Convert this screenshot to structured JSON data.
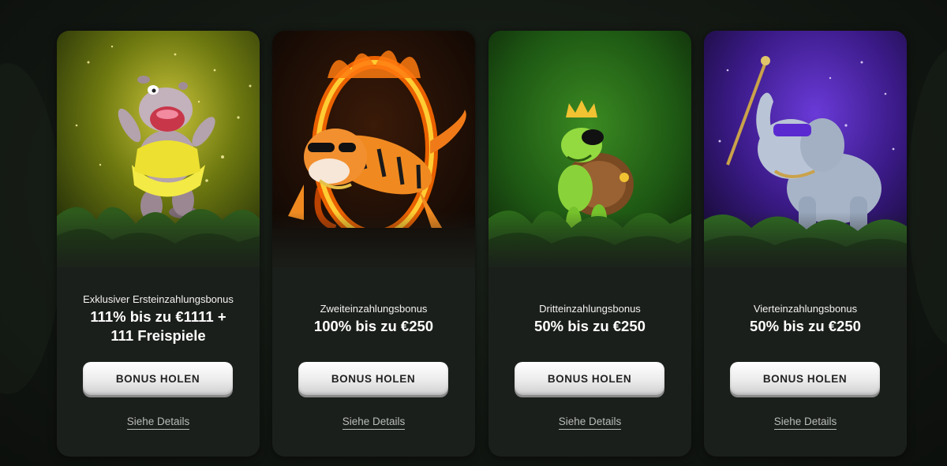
{
  "cards": [
    {
      "subtitle": "Exklusiver Ersteinzahlungsbonus",
      "offer": "111% bis zu €1111 + 111 Freispiele",
      "button_label": "BONUS HOLEN",
      "details_label": "Siehe Details",
      "mascot_icon": "hippo-icon",
      "bg_color": "#6f7a10"
    },
    {
      "subtitle": "Zweiteinzahlungsbonus",
      "offer": "100% bis zu €250",
      "button_label": "BONUS HOLEN",
      "details_label": "Siehe Details",
      "mascot_icon": "tiger-icon",
      "bg_color": "#1a0d06"
    },
    {
      "subtitle": "Dritteinzahlungsbonus",
      "offer": "50% bis zu €250",
      "button_label": "BONUS HOLEN",
      "details_label": "Siehe Details",
      "mascot_icon": "turtle-icon",
      "bg_color": "#1f5a14"
    },
    {
      "subtitle": "Vierteinzahlungsbonus",
      "offer": "50% bis zu €250",
      "button_label": "BONUS HOLEN",
      "details_label": "Siehe Details",
      "mascot_icon": "elephant-icon",
      "bg_color": "#3a1a86"
    }
  ]
}
